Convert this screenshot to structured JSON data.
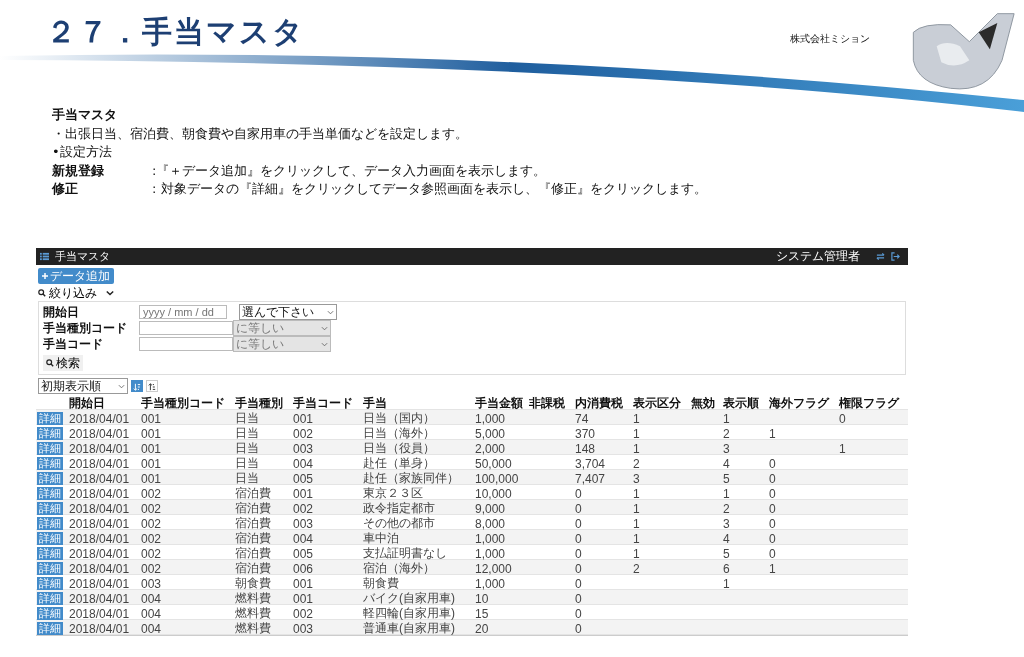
{
  "slide": {
    "title": "２７．手当マスタ",
    "company": "株式会社ミション"
  },
  "description": {
    "heading": "手当マスタ",
    "lines": [
      {
        "kind": "bullet",
        "text": "・出張日当、宿泊費、朝食費や自家用車の手当単価などを設定します。"
      },
      {
        "kind": "bullet",
        "text": "•設定方法"
      },
      {
        "kind": "labeled",
        "label": "新規登録",
        "text": ":『＋データ追加』をクリックして、データ入力画面を表示します。"
      },
      {
        "kind": "labeled",
        "label": "修正",
        "text": ": 対象データの『詳細』をクリックしてデータ参照画面を表示し、『修正』をクリックします。"
      }
    ]
  },
  "app": {
    "title": "手当マスタ",
    "user": "システム管理者",
    "add_button": "データ追加",
    "filter_toggle": "絞り込み",
    "filters": [
      {
        "label": "開始日",
        "placeholder": "yyyy / mm / dd",
        "operator": "選んで下さい",
        "disabled": false
      },
      {
        "label": "手当種別コード",
        "operator": "に等しい",
        "disabled": true
      },
      {
        "label": "手当コード",
        "operator": "に等しい",
        "disabled": true
      }
    ],
    "search_button": "検索",
    "sort_select": "初期表示順",
    "sort_buttons": [
      {
        "selected": true
      },
      {
        "selected": false
      }
    ],
    "table": {
      "columns": [
        "開始日",
        "手当種別コード",
        "手当種別",
        "手当コード",
        "手当",
        "手当金額",
        "非課税",
        "内消費税",
        "表示区分",
        "無効",
        "表示順",
        "海外フラグ",
        "権限フラグ"
      ],
      "detail_labels": [
        "詳細",
        "詳細",
        "詳細",
        "詳細",
        "詳細",
        "詳細",
        "詳細",
        "詳細",
        "詳細",
        "詳細",
        "詳細",
        "詳細",
        "詳細",
        "詳細",
        "詳細"
      ],
      "rows": [
        [
          "2018/04/01",
          "001",
          "日当",
          "001",
          "日当（国内）",
          "1,000",
          "",
          "74",
          "1",
          "",
          "1",
          "",
          "0"
        ],
        [
          "2018/04/01",
          "001",
          "日当",
          "002",
          "日当（海外）",
          "5,000",
          "",
          "370",
          "1",
          "",
          "2",
          "1",
          ""
        ],
        [
          "2018/04/01",
          "001",
          "日当",
          "003",
          "日当（役員）",
          "2,000",
          "",
          "148",
          "1",
          "",
          "3",
          "",
          "1"
        ],
        [
          "2018/04/01",
          "001",
          "日当",
          "004",
          "赴任（単身）",
          "50,000",
          "",
          "3,704",
          "2",
          "",
          "4",
          "0",
          ""
        ],
        [
          "2018/04/01",
          "001",
          "日当",
          "005",
          "赴任（家族同伴）",
          "100,000",
          "",
          "7,407",
          "3",
          "",
          "5",
          "0",
          ""
        ],
        [
          "2018/04/01",
          "002",
          "宿泊費",
          "001",
          "東京２３区",
          "10,000",
          "",
          "0",
          "1",
          "",
          "1",
          "0",
          ""
        ],
        [
          "2018/04/01",
          "002",
          "宿泊費",
          "002",
          "政令指定都市",
          "9,000",
          "",
          "0",
          "1",
          "",
          "2",
          "0",
          ""
        ],
        [
          "2018/04/01",
          "002",
          "宿泊費",
          "003",
          "その他の都市",
          "8,000",
          "",
          "0",
          "1",
          "",
          "3",
          "0",
          ""
        ],
        [
          "2018/04/01",
          "002",
          "宿泊費",
          "004",
          "車中泊",
          "1,000",
          "",
          "0",
          "1",
          "",
          "4",
          "0",
          ""
        ],
        [
          "2018/04/01",
          "002",
          "宿泊費",
          "005",
          "支払証明書なし",
          "1,000",
          "",
          "0",
          "1",
          "",
          "5",
          "0",
          ""
        ],
        [
          "2018/04/01",
          "002",
          "宿泊費",
          "006",
          "宿泊（海外）",
          "12,000",
          "",
          "0",
          "2",
          "",
          "6",
          "1",
          ""
        ],
        [
          "2018/04/01",
          "003",
          "朝食費",
          "001",
          "朝食費",
          "1,000",
          "",
          "0",
          "",
          "",
          "1",
          "",
          ""
        ],
        [
          "2018/04/01",
          "004",
          "燃料費",
          "001",
          "バイク(自家用車)",
          "10",
          "",
          "0",
          "",
          "",
          "",
          "",
          ""
        ],
        [
          "2018/04/01",
          "004",
          "燃料費",
          "002",
          "軽四輪(自家用車)",
          "15",
          "",
          "0",
          "",
          "",
          "",
          "",
          ""
        ],
        [
          "2018/04/01",
          "004",
          "燃料費",
          "003",
          "普通車(自家用車)",
          "20",
          "",
          "0",
          "",
          "",
          "",
          "",
          ""
        ]
      ]
    }
  }
}
